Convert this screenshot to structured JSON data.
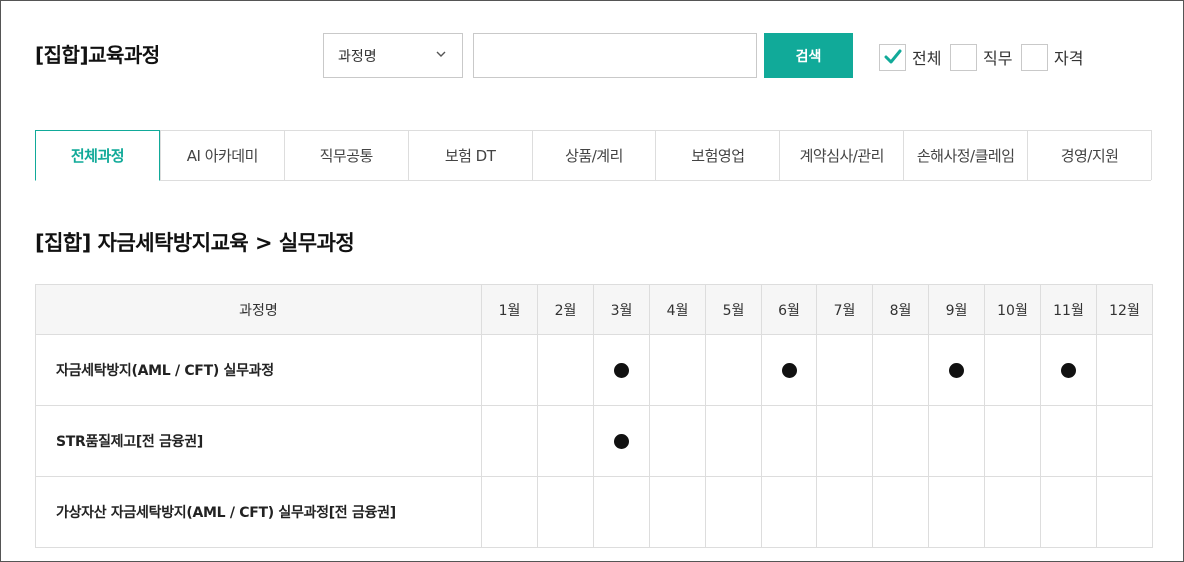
{
  "header": {
    "title": "[집합]교육과정"
  },
  "search": {
    "select_value": "과정명",
    "input_value": "",
    "button_label": "검색"
  },
  "filters": [
    {
      "label": "전체",
      "checked": true
    },
    {
      "label": "직무",
      "checked": false
    },
    {
      "label": "자격",
      "checked": false
    }
  ],
  "tabs": [
    {
      "label": "전체과정",
      "active": true
    },
    {
      "label": "AI 아카데미",
      "active": false
    },
    {
      "label": "직무공통",
      "active": false
    },
    {
      "label": "보험 DT",
      "active": false
    },
    {
      "label": "상품/계리",
      "active": false
    },
    {
      "label": "보험영업",
      "active": false
    },
    {
      "label": "계약심사/관리",
      "active": false
    },
    {
      "label": "손해사정/클레임",
      "active": false
    },
    {
      "label": "경영/지원",
      "active": false
    }
  ],
  "section": {
    "title": "[집합] 자금세탁방지교육 > 실무과정"
  },
  "table": {
    "name_header": "과정명",
    "months": [
      "1월",
      "2월",
      "3월",
      "4월",
      "5월",
      "6월",
      "7월",
      "8월",
      "9월",
      "10월",
      "11월",
      "12월"
    ],
    "rows": [
      {
        "name": "자금세탁방지(AML / CFT) 실무과정",
        "months": [
          3,
          6,
          9,
          11
        ]
      },
      {
        "name": "STR품질제고[전 금융권]",
        "months": [
          3
        ]
      },
      {
        "name": "가상자산 자금세탁방지(AML / CFT) 실무과정[전 금융권]",
        "months": []
      }
    ]
  },
  "colors": {
    "accent": "#11aa99",
    "border": "#dddddd",
    "header_bg": "#f6f6f6"
  },
  "icons": {
    "dropdown": "chevron-down-icon",
    "checked": "checkmark-icon",
    "scheduled": "filled-circle-icon"
  }
}
